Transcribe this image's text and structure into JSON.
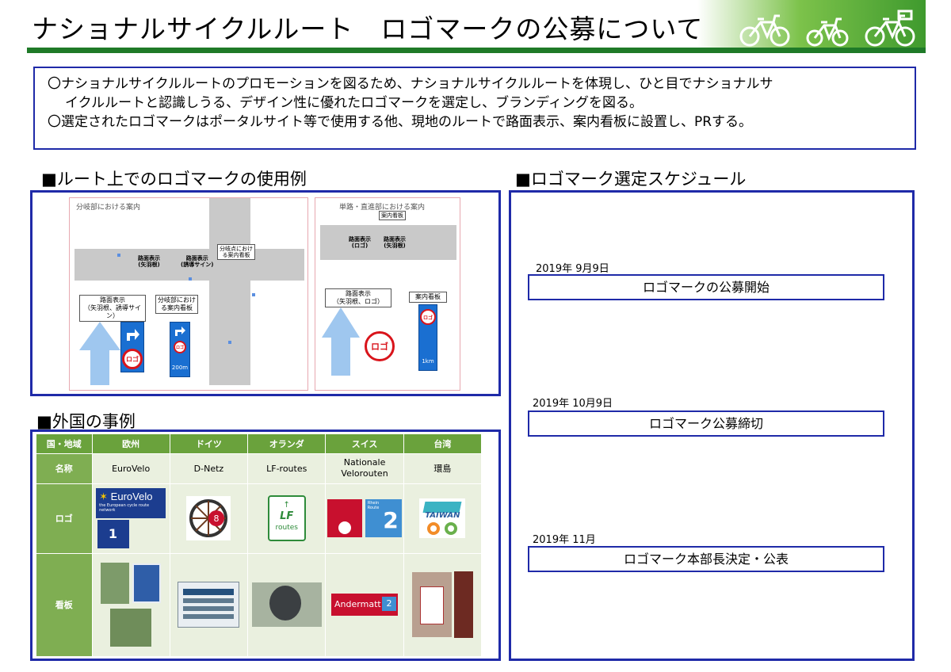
{
  "title": "ナショナルサイクルルート　ロゴマークの公募について",
  "intro": {
    "line1": "〇ナショナルサイクルルートのプロモーションを図るため、ナショナルサイクルルートを体現し、ひと目でナショナルサ",
    "line2": "イクルルートと認識しうる、デザイン性に優れたロゴマークを選定し、ブランディングを図る。",
    "line3": "〇選定されたロゴマークはポータルサイト等で使用する他、現地のルートで路面表示、案内看板に設置し、PRする。"
  },
  "usage": {
    "heading": "■ルート上でのロゴマークの使用例",
    "left": {
      "caption": "分岐部における案内",
      "road_mark_1": "路面表示\n(矢羽根)",
      "road_mark_2": "路面表示\n(誘導サイン)",
      "junction_note": "分岐点におけ\nる案内看板",
      "label_road": "路面表示\n（矢羽根、誘導サイン）",
      "label_sign": "分岐部におけ\nる案内看板",
      "logo_text": "ロゴ",
      "distance": "200m"
    },
    "right": {
      "caption": "単路・直進部における案内",
      "sign_note": "案内看板",
      "road_mark_1": "路面表示\n(ロゴ)",
      "road_mark_2": "路面表示\n(矢羽根)",
      "label_road": "路面表示\n（矢羽根、ロゴ）",
      "label_sign": "案内看板",
      "logo_text": "ロゴ",
      "distance": "1km"
    }
  },
  "foreign": {
    "heading": "■外国の事例",
    "headers": [
      "国・地域",
      "欧州",
      "ドイツ",
      "オランダ",
      "スイス",
      "台湾"
    ],
    "row_name_label": "名称",
    "names": [
      "EuroVelo",
      "D-Netz",
      "LF-routes",
      "Nationale\nVelorouten",
      "環島"
    ],
    "row_logo_label": "ロゴ",
    "row_sign_label": "看板",
    "logo_texts": {
      "eurovelo": "EuroVelo",
      "eurovelo_sub": "the European cycle route network",
      "eurovelo_num": "1",
      "dnetz_num": "8",
      "lf": "LF",
      "lf_routes": "routes",
      "swiss_num": "2",
      "swiss_route": "Rhein\nRoute",
      "taiwan": "TAIWAN"
    },
    "sign_texts": {
      "swiss_place": "Andermatt",
      "swiss_num": "2"
    }
  },
  "schedule": {
    "heading": "■ロゴマーク選定スケジュール",
    "items": [
      {
        "date": "2019年 9月9日",
        "label": "ロゴマークの公募開始"
      },
      {
        "date": "2019年 10月9日",
        "label": "ロゴマーク公募締切"
      },
      {
        "date": "2019年 11月",
        "label": "ロゴマーク本部長決定・公表"
      }
    ]
  },
  "colors": {
    "brand_green": "#1f7a28",
    "frame_blue": "#1f2aa8",
    "table_green": "#6aa23c",
    "sign_blue": "#1a6fd1",
    "logo_red": "#d9141b"
  }
}
